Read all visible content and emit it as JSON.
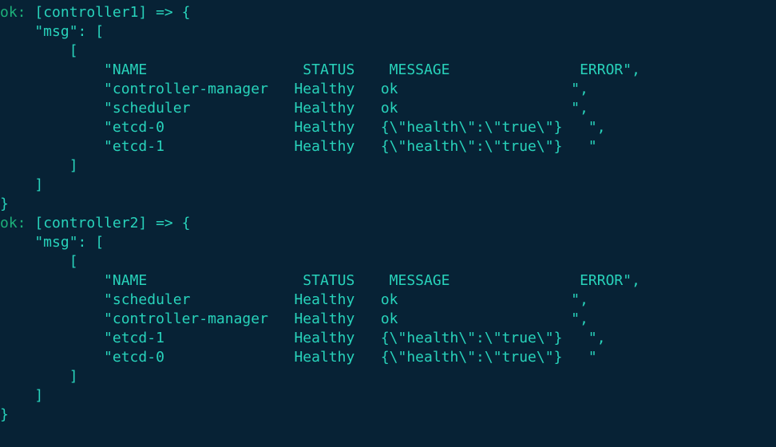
{
  "blocks": [
    {
      "status_prefix": "ok: ",
      "host": "[controller1]",
      "arrow": " => {",
      "msg_key": "    \"msg\"",
      "msg_open": ": [",
      "inner_open": "        [",
      "lines": [
        "            \"NAME                  STATUS    MESSAGE               ERROR\",",
        "            \"controller-manager   Healthy   ok                    \",",
        "            \"scheduler            Healthy   ok                    \",",
        "            \"etcd-0               Healthy   {\\\"health\\\":\\\"true\\\"}   \",",
        "            \"etcd-1               Healthy   {\\\"health\\\":\\\"true\\\"}   \""
      ],
      "inner_close": "        ]",
      "msg_close": "    ]",
      "block_close": "}"
    },
    {
      "status_prefix": "ok: ",
      "host": "[controller2]",
      "arrow": " => {",
      "msg_key": "    \"msg\"",
      "msg_open": ": [",
      "inner_open": "        [",
      "lines": [
        "            \"NAME                  STATUS    MESSAGE               ERROR\",",
        "            \"scheduler            Healthy   ok                    \",",
        "            \"controller-manager   Healthy   ok                    \",",
        "            \"etcd-1               Healthy   {\\\"health\\\":\\\"true\\\"}   \",",
        "            \"etcd-0               Healthy   {\\\"health\\\":\\\"true\\\"}   \""
      ],
      "inner_close": "        ]",
      "msg_close": "    ]",
      "block_close": "}"
    }
  ]
}
